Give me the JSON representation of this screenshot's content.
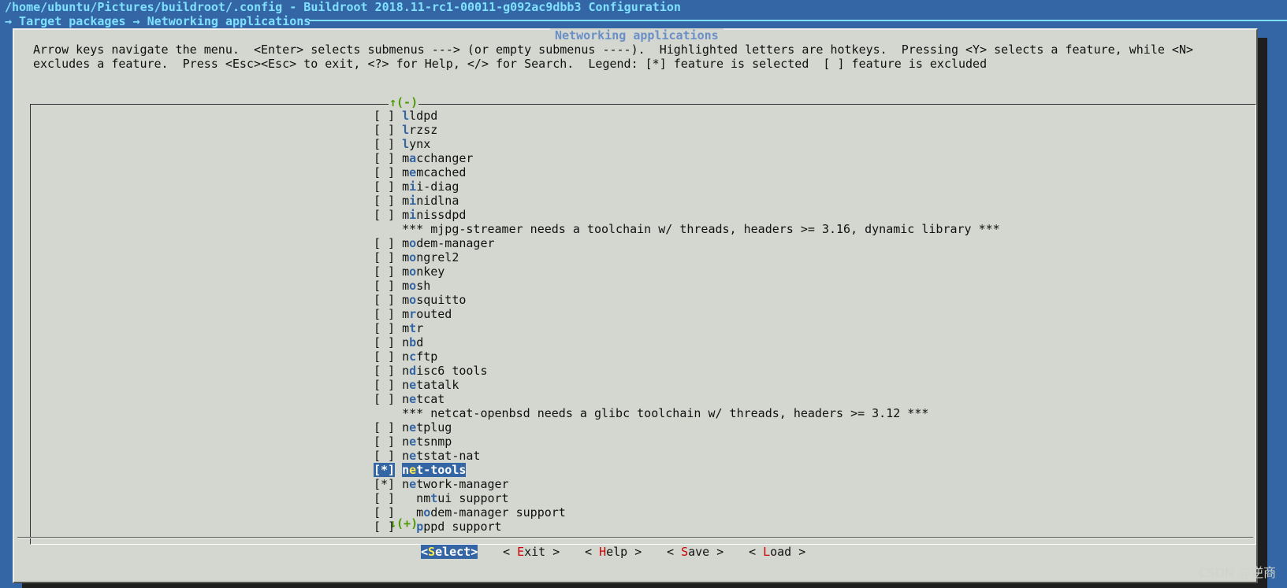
{
  "window": {
    "title": "/home/ubuntu/Pictures/buildroot/.config - Buildroot 2018.11-rc1-00011-g092ac9dbb3 Configuration",
    "breadcrumb": "→ Target packages → Networking applications"
  },
  "dialog": {
    "title": "Networking applications",
    "help_line1": "Arrow keys navigate the menu.  <Enter> selects submenus ---> (or empty submenus ----).  Highlighted letters are hotkeys.  Pressing <Y> selects a feature, while <N>",
    "help_line2": "excludes a feature.  Press <Esc><Esc> to exit, <?> for Help, </> for Search.  Legend: [*] feature is selected  [ ] feature is excluded",
    "scroll_up": "↑(-)",
    "scroll_down": "↓(+)"
  },
  "menu_items": [
    {
      "check": "[ ]",
      "pre": "",
      "hk": "l",
      "rest": "ldpd"
    },
    {
      "check": "[ ]",
      "pre": "",
      "hk": "l",
      "rest": "rzsz"
    },
    {
      "check": "[ ]",
      "pre": "",
      "hk": "l",
      "rest": "ynx"
    },
    {
      "check": "[ ]",
      "pre": "m",
      "hk": "a",
      "rest": "cchanger"
    },
    {
      "check": "[ ]",
      "pre": "m",
      "hk": "e",
      "rest": "mcached"
    },
    {
      "check": "[ ]",
      "pre": "m",
      "hk": "i",
      "rest": "i-diag"
    },
    {
      "check": "[ ]",
      "pre": "m",
      "hk": "i",
      "rest": "nidlna"
    },
    {
      "check": "[ ]",
      "pre": "m",
      "hk": "i",
      "rest": "nissdpd"
    },
    {
      "comment": "*** mjpg-streamer needs a toolchain w/ threads, headers >= 3.16, dynamic library ***"
    },
    {
      "check": "[ ]",
      "pre": "m",
      "hk": "o",
      "rest": "dem-manager"
    },
    {
      "check": "[ ]",
      "pre": "m",
      "hk": "o",
      "rest": "ngrel2"
    },
    {
      "check": "[ ]",
      "pre": "m",
      "hk": "o",
      "rest": "nkey"
    },
    {
      "check": "[ ]",
      "pre": "m",
      "hk": "o",
      "rest": "sh"
    },
    {
      "check": "[ ]",
      "pre": "m",
      "hk": "o",
      "rest": "squitto"
    },
    {
      "check": "[ ]",
      "pre": "m",
      "hk": "r",
      "rest": "outed"
    },
    {
      "check": "[ ]",
      "pre": "m",
      "hk": "t",
      "rest": "r"
    },
    {
      "check": "[ ]",
      "pre": "n",
      "hk": "b",
      "rest": "d"
    },
    {
      "check": "[ ]",
      "pre": "n",
      "hk": "c",
      "rest": "ftp"
    },
    {
      "check": "[ ]",
      "pre": "n",
      "hk": "d",
      "rest": "isc6 tools"
    },
    {
      "check": "[ ]",
      "pre": "n",
      "hk": "e",
      "rest": "tatalk"
    },
    {
      "check": "[ ]",
      "pre": "n",
      "hk": "e",
      "rest": "tcat"
    },
    {
      "comment": "*** netcat-openbsd needs a glibc toolchain w/ threads, headers >= 3.12 ***"
    },
    {
      "check": "[ ]",
      "pre": "n",
      "hk": "e",
      "rest": "tplug"
    },
    {
      "check": "[ ]",
      "pre": "n",
      "hk": "e",
      "rest": "tsnmp"
    },
    {
      "check": "[ ]",
      "pre": "n",
      "hk": "e",
      "rest": "tstat-nat"
    },
    {
      "check": "[*]",
      "pre": "n",
      "hk": "e",
      "rest": "t-tools",
      "selected": true
    },
    {
      "check": "[*]",
      "pre": "n",
      "hk": "e",
      "rest": "twork-manager"
    },
    {
      "check": "[ ]",
      "pre": "  nm",
      "hk": "t",
      "rest": "ui support"
    },
    {
      "check": "[ ]",
      "pre": "  m",
      "hk": "o",
      "rest": "dem-manager support"
    },
    {
      "check": "[ ]",
      "pre": "  ",
      "hk": "p",
      "rest": "ppd support"
    }
  ],
  "buttons": [
    {
      "pre": "<",
      "hk": "S",
      "rest": "elect>",
      "active": true,
      "name": "select-button"
    },
    {
      "pre": "< ",
      "hk": "E",
      "rest": "xit >",
      "active": false,
      "name": "exit-button"
    },
    {
      "pre": "< ",
      "hk": "H",
      "rest": "elp >",
      "active": false,
      "name": "help-button"
    },
    {
      "pre": "< ",
      "hk": "S",
      "rest": "ave >",
      "active": false,
      "name": "save-button"
    },
    {
      "pre": "< ",
      "hk": "L",
      "rest": "oad >",
      "active": false,
      "name": "load-button"
    }
  ],
  "watermark": "CSDN @逆商",
  "colors": {
    "background": "#3466a5",
    "dialog": "#d3d7cf",
    "title_text": "#7fe0ff",
    "item_hotkey": "#3465a4",
    "button_hotkey": "#cc0000",
    "scroll_indicator": "#4e9a06"
  }
}
